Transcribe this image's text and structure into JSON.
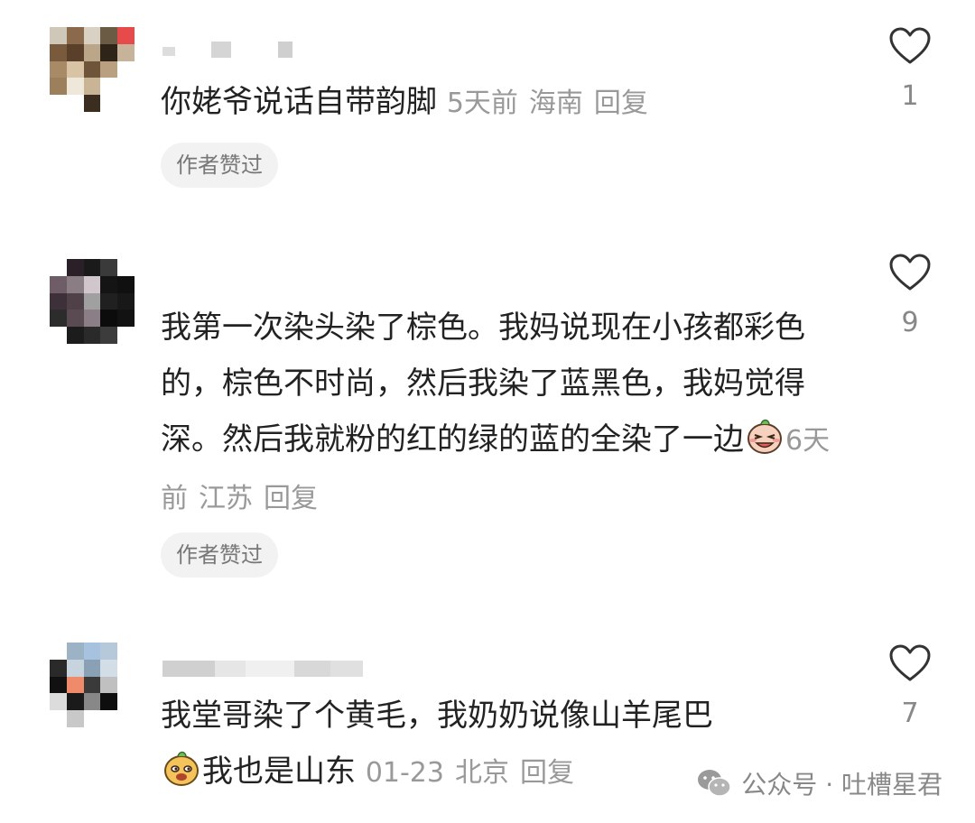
{
  "comments": [
    {
      "text": "你姥爷说话自带韵脚",
      "time": "5天前",
      "location": "海南",
      "reply": "回复",
      "badge": "作者赞过",
      "likes": "1"
    },
    {
      "text": "我第一次染头染了棕色。我妈说现在小孩都彩色的，棕色不时尚，然后我染了蓝黑色，我妈觉得深。然后我就粉的红的绿的蓝的全染了一边",
      "emoji": "laughing-emoji",
      "time": "6天前",
      "location": "江苏",
      "reply": "回复",
      "badge": "作者赞过",
      "likes": "9"
    },
    {
      "text": "我堂哥染了个黄毛，我奶奶说像山羊尾巴",
      "emoji": "smug-emoji",
      "text2": "我也是山东",
      "time": "01-23",
      "location": "北京",
      "reply": "回复",
      "likes": "7"
    }
  ],
  "watermark": {
    "text": "公众号 · 吐槽星君",
    "icon": "wechat-icon"
  },
  "colors": {
    "text": "#222222",
    "meta": "#999999",
    "badge_bg": "#f2f2f2",
    "badge_text": "#777777"
  }
}
